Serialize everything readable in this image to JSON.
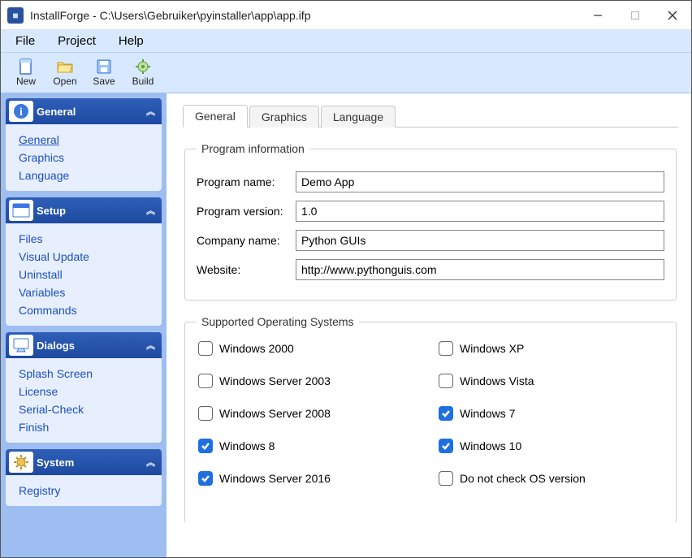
{
  "window": {
    "title": "InstallForge - C:\\Users\\Gebruiker\\pyinstaller\\app\\app.ifp"
  },
  "menubar": {
    "items": [
      "File",
      "Project",
      "Help"
    ]
  },
  "toolbar": {
    "items": [
      {
        "name": "new-button",
        "label": "New"
      },
      {
        "name": "open-button",
        "label": "Open"
      },
      {
        "name": "save-button",
        "label": "Save"
      },
      {
        "name": "build-button",
        "label": "Build"
      }
    ]
  },
  "sidebar": {
    "sections": [
      {
        "name": "general",
        "title": "General",
        "icon": "info-icon",
        "items": [
          {
            "label": "General",
            "selected": true
          },
          {
            "label": "Graphics",
            "selected": false
          },
          {
            "label": "Language",
            "selected": false
          }
        ]
      },
      {
        "name": "setup",
        "title": "Setup",
        "icon": "window-icon",
        "items": [
          {
            "label": "Files"
          },
          {
            "label": "Visual Update"
          },
          {
            "label": "Uninstall"
          },
          {
            "label": "Variables"
          },
          {
            "label": "Commands"
          }
        ]
      },
      {
        "name": "dialogs",
        "title": "Dialogs",
        "icon": "screen-icon",
        "items": [
          {
            "label": "Splash Screen"
          },
          {
            "label": "License"
          },
          {
            "label": "Serial-Check"
          },
          {
            "label": "Finish"
          }
        ]
      },
      {
        "name": "system",
        "title": "System",
        "icon": "gear-icon",
        "items": [
          {
            "label": "Registry"
          }
        ]
      }
    ]
  },
  "tabs": {
    "items": [
      {
        "label": "General",
        "active": true
      },
      {
        "label": "Graphics",
        "active": false
      },
      {
        "label": "Language",
        "active": false
      }
    ]
  },
  "form": {
    "program_info": {
      "legend": "Program information",
      "fields": {
        "program_name": {
          "label": "Program name:",
          "value": "Demo App"
        },
        "program_version": {
          "label": "Program version:",
          "value": "1.0"
        },
        "company_name": {
          "label": "Company name:",
          "value": "Python GUIs"
        },
        "website": {
          "label": "Website:",
          "value": "http://www.pythonguis.com"
        }
      }
    },
    "supported_os": {
      "legend": "Supported Operating Systems",
      "options": [
        {
          "label": "Windows 2000",
          "checked": false
        },
        {
          "label": "Windows XP",
          "checked": false
        },
        {
          "label": "Windows Server 2003",
          "checked": false
        },
        {
          "label": "Windows Vista",
          "checked": false
        },
        {
          "label": "Windows Server 2008",
          "checked": false
        },
        {
          "label": "Windows 7",
          "checked": true
        },
        {
          "label": "Windows 8",
          "checked": true
        },
        {
          "label": "Windows 10",
          "checked": true
        },
        {
          "label": "Windows Server 2016",
          "checked": true
        },
        {
          "label": "Do not check OS version",
          "checked": false
        }
      ]
    }
  }
}
